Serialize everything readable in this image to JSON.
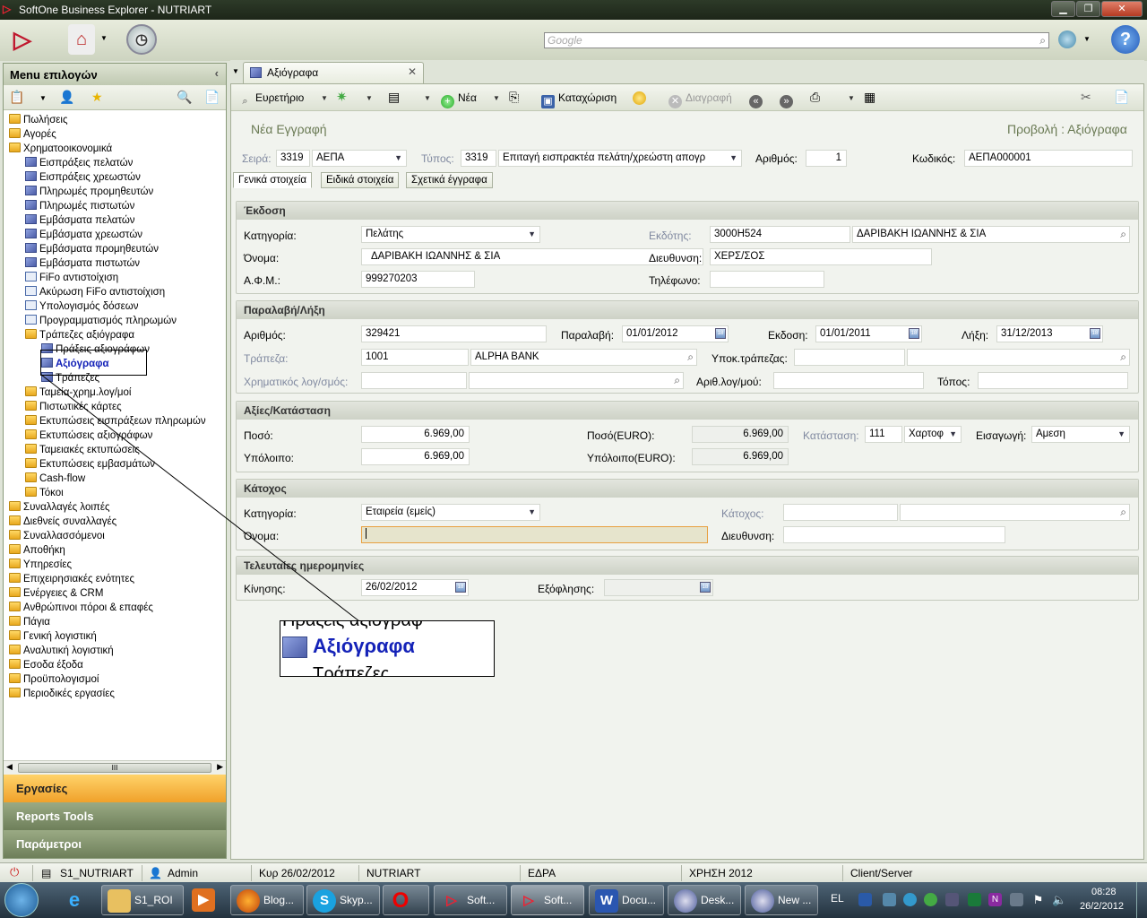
{
  "window": {
    "title": "SoftOne Business Explorer - NUTRIART"
  },
  "topbar": {
    "search_placeholder": "Google"
  },
  "left": {
    "menu_title": "Menu επιλογών",
    "tree": [
      {
        "label": "Πωλήσεις",
        "icon": "folder-icon",
        "level": 0
      },
      {
        "label": "Αγορές",
        "icon": "folder-icon",
        "level": 0
      },
      {
        "label": "Χρηματοοικονομικά",
        "icon": "folder-icon",
        "level": 0
      },
      {
        "label": "Εισπράξεις πελατών",
        "icon": "module-icon",
        "level": 1
      },
      {
        "label": "Εισπράξεις χρεωστών",
        "icon": "module-icon",
        "level": 1
      },
      {
        "label": "Πληρωμές προμηθευτών",
        "icon": "module-icon",
        "level": 1
      },
      {
        "label": "Πληρωμές πιστωτών",
        "icon": "module-icon",
        "level": 1
      },
      {
        "label": "Εμβάσματα πελατών",
        "icon": "module-icon",
        "level": 1
      },
      {
        "label": "Εμβάσματα χρεωστών",
        "icon": "module-icon",
        "level": 1
      },
      {
        "label": "Εμβάσματα προμηθευτών",
        "icon": "module-icon",
        "level": 1
      },
      {
        "label": "Εμβάσματα πιστωτών",
        "icon": "module-icon",
        "level": 1
      },
      {
        "label": "FiFo αντιστοίχιση",
        "icon": "chart-icon",
        "level": 1
      },
      {
        "label": "Ακύρωση FiFo αντιστοίχιση",
        "icon": "chart-icon",
        "level": 1
      },
      {
        "label": "Υπολογισμός δόσεων",
        "icon": "chart-icon",
        "level": 1
      },
      {
        "label": "Προγραμματισμός πληρωμών",
        "icon": "chart-icon",
        "level": 1
      },
      {
        "label": "Τράπεζες αξιόγραφα",
        "icon": "folder-icon",
        "level": 1
      },
      {
        "label": "Πράξεις αξιογράφων",
        "icon": "module-icon",
        "level": 2
      },
      {
        "label": "Αξιόγραφα",
        "icon": "module-icon",
        "level": 2,
        "selected": true
      },
      {
        "label": "Τράπεζες",
        "icon": "module-icon",
        "level": 2
      },
      {
        "label": "Ταμεία-χρημ.λογ/μοί",
        "icon": "folder-icon",
        "level": 1
      },
      {
        "label": "Πιστωτικές κάρτες",
        "icon": "folder-icon",
        "level": 1
      },
      {
        "label": "Εκτυπώσεις εισπράξεων πληρωμών",
        "icon": "folder-icon",
        "level": 1
      },
      {
        "label": "Εκτυπώσεις αξιογράφων",
        "icon": "folder-icon",
        "level": 1
      },
      {
        "label": "Ταμειακές εκτυπώσεις",
        "icon": "folder-icon",
        "level": 1
      },
      {
        "label": "Εκτυπώσεις εμβασμάτων",
        "icon": "folder-icon",
        "level": 1
      },
      {
        "label": "Cash-flow",
        "icon": "folder-icon",
        "level": 1
      },
      {
        "label": "Τόκοι",
        "icon": "folder-icon",
        "level": 1
      },
      {
        "label": "Συναλλαγές λοιπές",
        "icon": "folder-icon",
        "level": 0
      },
      {
        "label": "Διεθνείς συναλλαγές",
        "icon": "folder-icon",
        "level": 0
      },
      {
        "label": "Συναλλασσόμενοι",
        "icon": "folder-icon",
        "level": 0
      },
      {
        "label": "Αποθήκη",
        "icon": "folder-icon",
        "level": 0
      },
      {
        "label": "Υπηρεσίες",
        "icon": "folder-icon",
        "level": 0
      },
      {
        "label": "Επιχειρησιακές ενότητες",
        "icon": "folder-icon",
        "level": 0
      },
      {
        "label": "Ενέργειες & CRM",
        "icon": "folder-icon",
        "level": 0
      },
      {
        "label": "Ανθρώπινοι πόροι & επαφές",
        "icon": "folder-icon",
        "level": 0
      },
      {
        "label": "Πάγια",
        "icon": "folder-icon",
        "level": 0
      },
      {
        "label": "Γενική λογιστική",
        "icon": "folder-icon",
        "level": 0
      },
      {
        "label": "Αναλυτική λογιστική",
        "icon": "folder-icon",
        "level": 0
      },
      {
        "label": "Εσοδα έξοδα",
        "icon": "folder-icon",
        "level": 0
      },
      {
        "label": "Προϋπολογισμοί",
        "icon": "folder-icon",
        "level": 0
      },
      {
        "label": "Περιοδικές εργασίες",
        "icon": "folder-icon",
        "level": 0
      }
    ],
    "scroll_grip": "III",
    "bottom_buttons": [
      "Εργασίες",
      "Reports Tools",
      "Παράμετροι"
    ]
  },
  "tab": {
    "label": "Αξιόγραφα"
  },
  "toolbar": {
    "browser": "Ευρετήριο",
    "new": "Νέα",
    "save": "Καταχώριση",
    "delete": "Διαγραφή"
  },
  "form": {
    "header_left": "Νέα Εγγραφή",
    "header_right": "Προβολή : Αξιόγραφα",
    "series_label": "Σειρά:",
    "series_code": "3319",
    "series_name": "ΑΕΠΑ",
    "type_label": "Τύπος:",
    "type_code": "3319",
    "type_name": "Επιταγή εισπρακτέα πελάτη/χρεώστη  απογρ",
    "number_label": "Αριθμός:",
    "number_value": "1",
    "code_label": "Κωδικός:",
    "code_value": "ΑΕΠΑ000001",
    "subtabs": [
      "Γενικά στοιχεία",
      "Ειδικά στοιχεία",
      "Σχετικά έγγραφα"
    ],
    "issue": {
      "title": "Έκδοση",
      "category_label": "Κατηγορία:",
      "category_value": "Πελάτης",
      "issuer_label": "Εκδότης:",
      "issuer_code": "3000Η524",
      "issuer_name": "ΔΑΡΙΒΑΚΗ ΙΩΑΝΝΗΣ & ΣΙΑ",
      "name_label": "Όνομα:",
      "name_value": "ΔΑΡΙΒΑΚΗ ΙΩΑΝΝΗΣ & ΣΙΑ",
      "address_label": "Διευθυνση:",
      "address_value": "ΧΕΡΣ/ΣΟΣ",
      "afm_label": "Α.Φ.Μ.:",
      "afm_value": "999270203",
      "phone_label": "Τηλέφωνο:"
    },
    "receipt": {
      "title": "Παραλαβή/Λήξη",
      "number_label": "Αριθμός:",
      "number_value": "329421",
      "received_label": "Παραλαβή:",
      "received_value": "01/01/2012",
      "issued_label": "Εκδοση:",
      "issued_value": "01/01/2011",
      "due_label": "Λήξη:",
      "due_value": "31/12/2013",
      "bank_label": "Τράπεζα:",
      "bank_code": "1001",
      "bank_name": "ALPHA BANK",
      "branch_label": "Υποκ.τράπεζας:",
      "account_label": "Χρηματικός λογ/σμός:",
      "account_no_label": "Αριθ.λογ/μού:",
      "place_label": "Τόπος:"
    },
    "values": {
      "title": "Αξίες/Κατάσταση",
      "amount_label": "Ποσό:",
      "amount_value": "6.969,00",
      "amount_euro_label": "Ποσό(EURO):",
      "amount_euro_value": "6.969,00",
      "status_label": "Κατάσταση:",
      "status_code": "111",
      "status_name": "Χαρτοφ",
      "import_label": "Εισαγωγή:",
      "import_value": "Αμεση",
      "balance_label": "Υπόλοιπο:",
      "balance_value": "6.969,00",
      "balance_euro_label": "Υπόλοιπο(EURO):",
      "balance_euro_value": "6.969,00"
    },
    "holder": {
      "title": "Κάτοχος",
      "category_label": "Κατηγορία:",
      "category_value": "Εταιρεία (εμείς)",
      "holder_label": "Κάτοχος:",
      "name_label": "Όνομα:",
      "address_label": "Διευθυνση:"
    },
    "dates": {
      "title": "Τελευταίες ημερομηνίες",
      "movement_label": "Κίνησης:",
      "movement_value": "26/02/2012",
      "settlement_label": "Εξόφλησης:"
    }
  },
  "zoom": {
    "above": "Πράξεις αξιογράφ",
    "main": "Αξιόγραφα",
    "below": "Τράπεζες"
  },
  "statusbar": {
    "db": "S1_NUTRIART",
    "user": "Admin",
    "date": "Κυρ 26/02/2012",
    "company": "NUTRIART",
    "branch": "ΕΔΡΑ",
    "year": "ΧΡΗΣΗ 2012",
    "mode": "Client/Server"
  },
  "taskbar": {
    "items": [
      "S1_ROI",
      "Blog...",
      "Skyp...",
      "Soft...",
      "Soft...",
      "Docu...",
      "Desk...",
      "New ..."
    ],
    "lang": "EL",
    "time": "08:28",
    "date": "26/2/2012"
  }
}
